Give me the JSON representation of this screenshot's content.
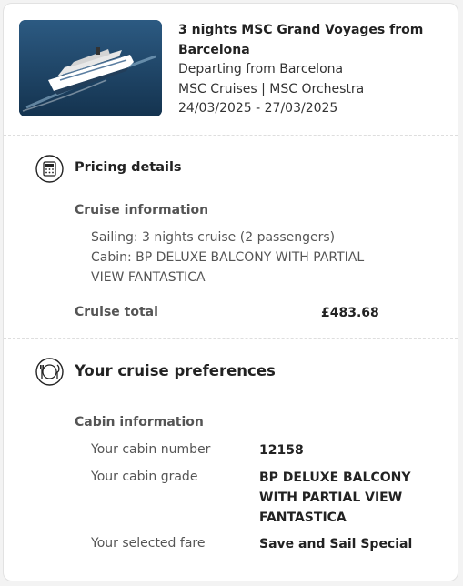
{
  "booking": {
    "title": "3 nights MSC Grand Voyages from Barcelona",
    "departure": "Departing from Barcelona",
    "line_ship": "MSC Cruises | MSC Orchestra",
    "dates": "24/03/2025 - 27/03/2025",
    "image_icon": "cruise-ship-photo"
  },
  "pricing": {
    "heading": "Pricing details",
    "icon": "calculator-icon",
    "cruise_info_heading": "Cruise information",
    "sailing": "Sailing: 3 nights cruise (2 passengers)",
    "cabin": "Cabin: BP DELUXE BALCONY WITH PARTIAL VIEW FANTASTICA",
    "total_label": "Cruise total",
    "total_value": "£483.68"
  },
  "preferences": {
    "heading": "Your cruise preferences",
    "icon": "dining-plate-icon",
    "cabin_info_heading": "Cabin information",
    "rows": [
      {
        "label": "Your cabin number",
        "value": "12158"
      },
      {
        "label": "Your cabin grade",
        "value": "BP DELUXE BALCONY WITH PARTIAL VIEW FANTASTICA"
      },
      {
        "label": "Your selected fare",
        "value": "Save and Sail Special"
      }
    ]
  }
}
